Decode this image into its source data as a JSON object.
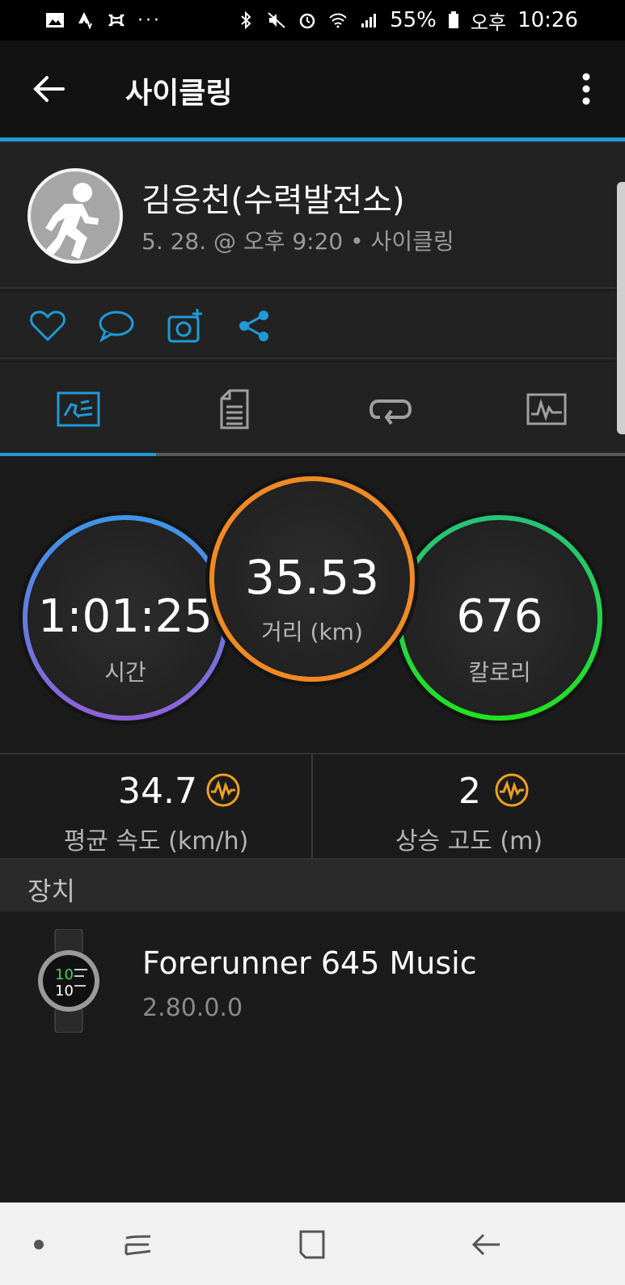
{
  "status_bar": {
    "battery": "55%",
    "ampm": "오후",
    "time": "10:26",
    "left_icons": [
      "image-icon",
      "strava-icon",
      "under-armour-icon",
      "more-notifications-icon"
    ],
    "right_icons": [
      "bluetooth-icon",
      "mute-icon",
      "alarm-icon",
      "wifi-icon",
      "signal-icon",
      "battery-icon"
    ]
  },
  "app_bar": {
    "title": "사이클링"
  },
  "profile": {
    "name": "김응천(수력발전소)",
    "meta": "5. 28. @ 오후 9:20 • 사이클링"
  },
  "actions": [
    "heart-icon",
    "comment-icon",
    "add-photo-icon",
    "share-icon"
  ],
  "tabs": [
    {
      "name": "summary",
      "icon": "summary-icon",
      "selected": true
    },
    {
      "name": "details",
      "icon": "details-icon",
      "selected": false
    },
    {
      "name": "laps",
      "icon": "laps-icon",
      "selected": false
    },
    {
      "name": "charts",
      "icon": "charts-icon",
      "selected": false
    }
  ],
  "rings": {
    "time": {
      "value": "1:01:25",
      "label": "시간"
    },
    "distance": {
      "value": "35.53",
      "label": "거리 (km)"
    },
    "calories": {
      "value": "676",
      "label": "칼로리"
    }
  },
  "metrics": {
    "avg_speed": {
      "value": "34.7",
      "label": "평균 속도 (km/h)"
    },
    "elevation_gain": {
      "value": "2",
      "label": "상승 고도 (m)"
    }
  },
  "section": {
    "title": "장치"
  },
  "device": {
    "name": "Forerunner 645 Music",
    "version": "2.80.0.0"
  },
  "colors": {
    "accent": "#1e9bd7",
    "time_ring": "#5a7fd8",
    "distance_ring": "#f08a24",
    "calories_ring": "#1fd44a",
    "metric_icon": "#f0a020"
  }
}
